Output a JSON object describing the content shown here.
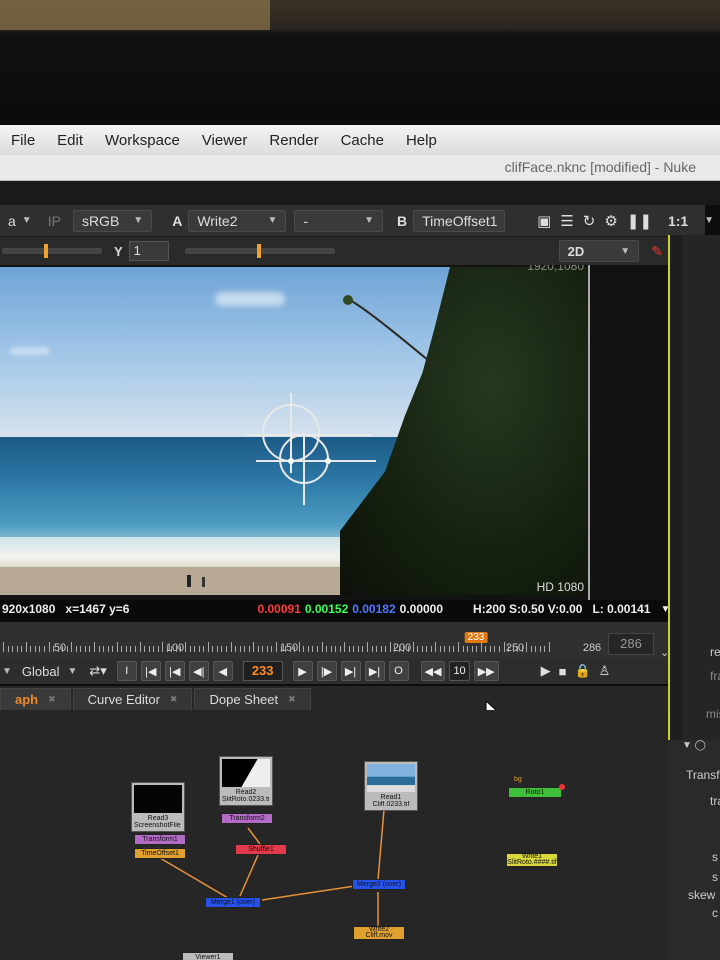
{
  "menu": [
    "File",
    "Edit",
    "Workspace",
    "Viewer",
    "Render",
    "Cache",
    "Help"
  ],
  "window_title": "clifFace.nknc [modified] - Nuke",
  "viewer_toolbar": {
    "channel_short": "a",
    "ip_label": "IP",
    "colorspace": "sRGB",
    "input_a_label": "A",
    "input_a": "Write2",
    "compare_mode": "-",
    "input_b_label": "B",
    "input_b": "TimeOffset1",
    "zoom": "1:1",
    "gamma_label": "Y",
    "gamma_value": "1",
    "view_mode": "2D"
  },
  "viewer": {
    "format_top": "1920,1080",
    "format_label": "HD 1080"
  },
  "info_bar": {
    "resolution": "920x1080",
    "cursor": "x=1467 y=6",
    "r": "0.00091",
    "g": "0.00152",
    "b": "0.00182",
    "a": "0.00000",
    "hsv": "H:200 S:0.50 V:0.00",
    "luma": "L: 0.00141"
  },
  "timeline": {
    "labels": [
      "50",
      "100",
      "150",
      "200",
      "250",
      "286"
    ],
    "current_frame": "233",
    "end_frame": "286"
  },
  "transport": {
    "scope": "Global",
    "frame": "233",
    "increment": "10",
    "in_label": "I",
    "out_label": "O"
  },
  "tabs": [
    "aph",
    "Curve Editor",
    "Dope Sheet"
  ],
  "nodes": {
    "read3": "Read3",
    "read3_sub": "ScreenshotFile (1920x1080)",
    "transform1": "Transform1",
    "timeoffset1": "TimeOffset1",
    "read2": "Read2",
    "read2_sub": "SlitRoto.0233.tif (RGB)",
    "transform2": "Transform2",
    "shuffle1": "Shuffle1",
    "merge1": "Merge1 (over)",
    "read1": "Read1",
    "read1_sub": "Cliff.0233.tif",
    "merge2": "Merge2 (over)",
    "write2": "Write2",
    "write2_sub": "Cliff.mov",
    "roto1": "Roto1",
    "roto_label": "bg",
    "write1": "Write1",
    "write1_sub": "SlitRoto.####.tif",
    "viewer1": "Viewer1"
  },
  "right_panel": {
    "frag1": "re",
    "frag2": "fra",
    "frag3": "missi",
    "transform": "Transf",
    "tra": "tra",
    "skew": "skew",
    "s1": "s",
    "s2": "s",
    "c": "c"
  }
}
